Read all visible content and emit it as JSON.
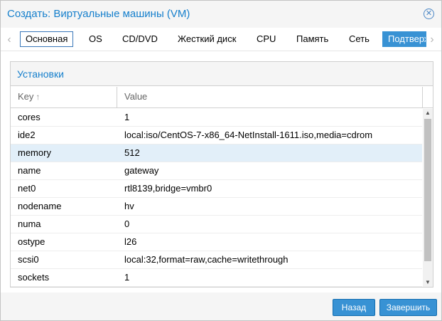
{
  "window": {
    "title": "Создать: Виртуальные машины (VM)",
    "close_icon": "close-circle-icon"
  },
  "tabs": {
    "scroll_left_icon": "chevron-left-icon",
    "scroll_right_icon": "chevron-right-icon",
    "items": [
      {
        "label": "Основная"
      },
      {
        "label": "OS"
      },
      {
        "label": "CD/DVD"
      },
      {
        "label": "Жесткий диск"
      },
      {
        "label": "CPU"
      },
      {
        "label": "Память"
      },
      {
        "label": "Сеть"
      },
      {
        "label": "Подтверждение"
      }
    ],
    "active": "Основная",
    "highlighted": "Подтверждение"
  },
  "panel": {
    "title": "Установки",
    "columns": {
      "key": "Key",
      "value": "Value"
    },
    "sort_icon": "sort-ascending-arrow-icon",
    "selected_row": "memory",
    "rows": [
      {
        "key": "cores",
        "value": "1"
      },
      {
        "key": "ide2",
        "value": "local:iso/CentOS-7-x86_64-NetInstall-1611.iso,media=cdrom"
      },
      {
        "key": "memory",
        "value": "512"
      },
      {
        "key": "name",
        "value": "gateway"
      },
      {
        "key": "net0",
        "value": "rtl8139,bridge=vmbr0"
      },
      {
        "key": "nodename",
        "value": "hv"
      },
      {
        "key": "numa",
        "value": "0"
      },
      {
        "key": "ostype",
        "value": "l26"
      },
      {
        "key": "scsi0",
        "value": "local:32,format=raw,cache=writethrough"
      },
      {
        "key": "sockets",
        "value": "1"
      }
    ]
  },
  "footer": {
    "back_label": "Назад",
    "finish_label": "Завершить"
  },
  "colors": {
    "accent": "#157fcc",
    "button_bg": "#3892d4",
    "selected_row": "#e2eff9"
  }
}
